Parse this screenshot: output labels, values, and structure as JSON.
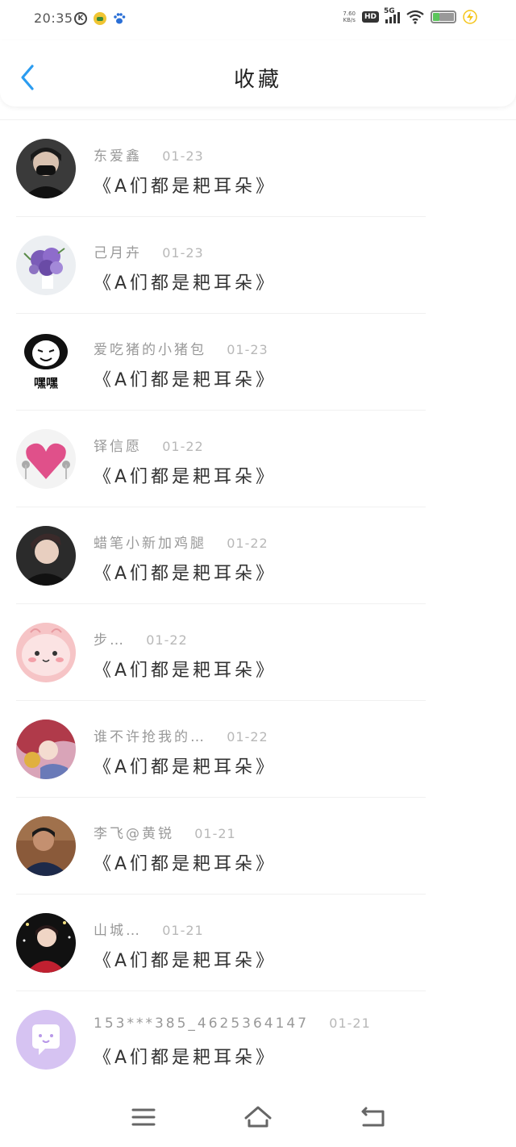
{
  "status_bar": {
    "time": "20:35",
    "net_speed_value": "7.60",
    "net_speed_unit": "KB/s",
    "hd": "HD",
    "network": "5G",
    "icons": [
      "k-icon",
      "app-icon",
      "paw-icon",
      "signal-icon",
      "wifi-icon",
      "battery-icon",
      "charging-icon"
    ]
  },
  "header": {
    "title": "收藏",
    "back_icon": "chevron-left-icon",
    "accent_color": "#2b9cf0"
  },
  "favorites": [
    {
      "user": "东爱鑫",
      "date": "01-23",
      "title": "《A们都是耙耳朵》"
    },
    {
      "user": "己月卉",
      "date": "01-23",
      "title": "《A们都是耙耳朵》"
    },
    {
      "user": "爱吃猪的小猪包",
      "date": "01-23",
      "title": "《A们都是耙耳朵》",
      "avatar_text": "嘿嘿"
    },
    {
      "user": "铎信愿",
      "date": "01-22",
      "title": "《A们都是耙耳朵》"
    },
    {
      "user": "蜡笔小新加鸡腿",
      "date": "01-22",
      "title": "《A们都是耙耳朵》"
    },
    {
      "user": "步…",
      "date": "01-22",
      "title": "《A们都是耙耳朵》"
    },
    {
      "user": "谁不许抢我的…",
      "date": "01-22",
      "title": "《A们都是耙耳朵》"
    },
    {
      "user": "李飞@黄锐",
      "date": "01-21",
      "title": "《A们都是耙耳朵》"
    },
    {
      "user": "山城…",
      "date": "01-21",
      "title": "《A们都是耙耳朵》"
    },
    {
      "user": "153***385_4625364147",
      "date": "01-21",
      "title": "《A们都是耙耳朵》"
    }
  ],
  "nav_bar": {
    "icons": [
      "menu-icon",
      "home-icon",
      "back-icon"
    ]
  }
}
